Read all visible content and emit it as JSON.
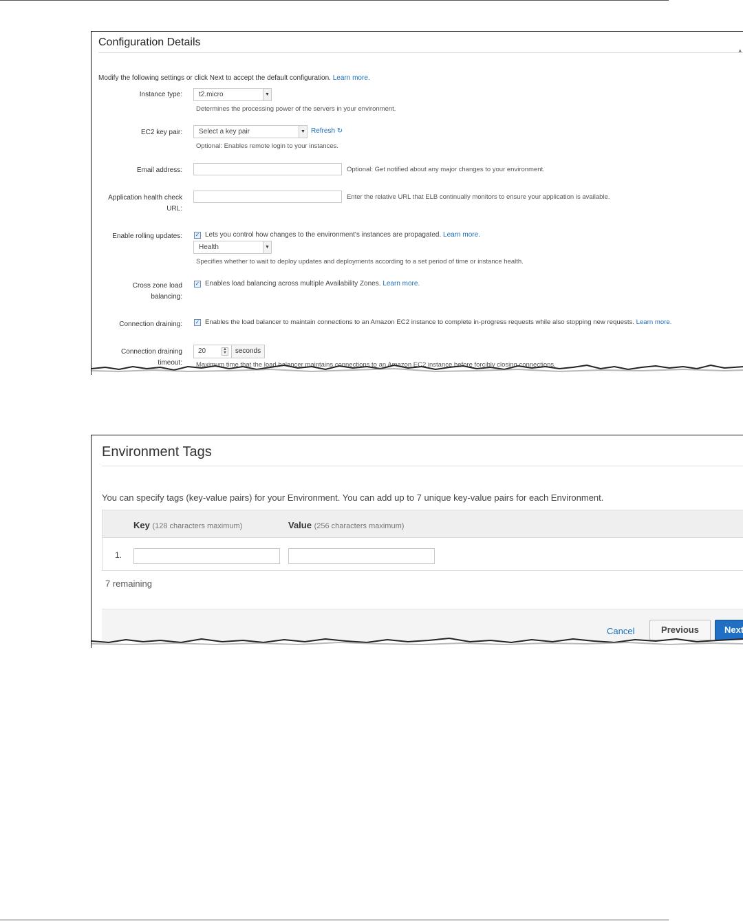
{
  "config": {
    "title": "Configuration Details",
    "intro": "Modify the following settings or click Next to accept the default configuration.",
    "intro_link": "Learn more.",
    "instance_type": {
      "label": "Instance type:",
      "value": "t2.micro",
      "help": "Determines the processing power of the servers in your environment."
    },
    "key_pair": {
      "label": "EC2 key pair:",
      "value": "Select a key pair",
      "refresh": "Refresh",
      "help": "Optional: Enables remote login to your instances."
    },
    "email": {
      "label": "Email address:",
      "value": "",
      "help": "Optional: Get notified about any major changes to your environment."
    },
    "health_check": {
      "label_line1": "Application health check",
      "label_line2": "URL:",
      "value": "",
      "help": "Enter the relative URL that ELB continually monitors to ensure your application is available."
    },
    "rolling_updates": {
      "label": "Enable rolling updates:",
      "checked": true,
      "text": "Lets you control how changes to the environment's instances are propagated.",
      "link": "Learn more.",
      "select_value": "Health",
      "help": "Specifies whether to wait to deploy updates and deployments according to a set period of time or instance health."
    },
    "cross_zone": {
      "label_line1": "Cross zone load",
      "label_line2": "balancing:",
      "checked": true,
      "text": "Enables load balancing across multiple Availability Zones.",
      "link": "Learn more."
    },
    "draining": {
      "label": "Connection draining:",
      "checked": true,
      "text": "Enables the load balancer to maintain connections to an Amazon EC2 instance to complete in-progress requests while also stopping new requests.",
      "link": "Learn more."
    },
    "draining_timeout": {
      "label_line1": "Connection draining",
      "label_line2": "timeout:",
      "value": "20",
      "unit": "seconds",
      "help": "Maximum time that the load balancer maintains connections to an Amazon EC2 instance before forcibly closing connections."
    }
  },
  "tags": {
    "title": "Environment Tags",
    "intro": "You can specify tags (key-value pairs) for your Environment. You can add up to 7 unique key-value pairs for each Environment.",
    "key_header": "Key",
    "key_sub": "(128 characters maximum)",
    "value_header": "Value",
    "value_sub": "(256 characters maximum)",
    "rows": [
      {
        "num": "1.",
        "key": "",
        "value": ""
      }
    ],
    "remaining": "7 remaining",
    "cancel": "Cancel",
    "previous": "Previous",
    "next": "Next"
  }
}
